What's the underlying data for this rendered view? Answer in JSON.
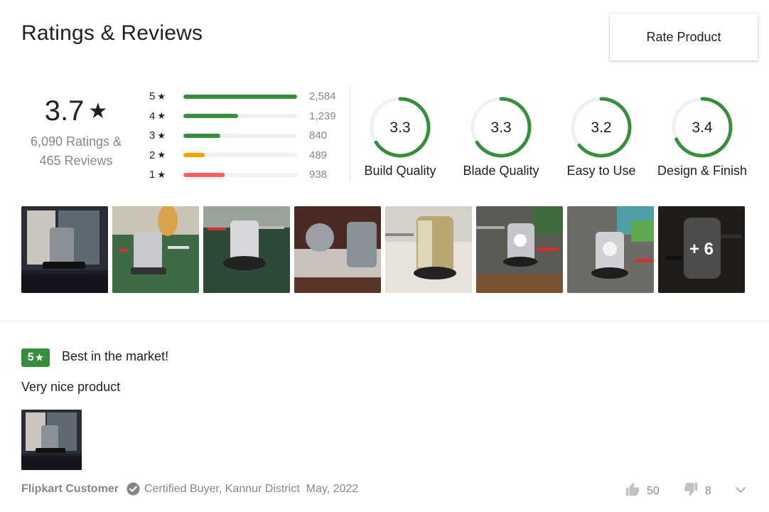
{
  "header": {
    "title": "Ratings & Reviews",
    "rate_button": "Rate Product"
  },
  "summary": {
    "average": "3.7",
    "star": "★",
    "ratings_line": "6,090 Ratings &",
    "reviews_line": "465 Reviews"
  },
  "distribution": [
    {
      "stars": "5",
      "count": "2,584",
      "fraction": 1.0,
      "color": "#388e3c"
    },
    {
      "stars": "4",
      "count": "1,239",
      "fraction": 0.48,
      "color": "#388e3c"
    },
    {
      "stars": "3",
      "count": "840",
      "fraction": 0.325,
      "color": "#388e3c"
    },
    {
      "stars": "2",
      "count": "489",
      "fraction": 0.19,
      "color": "#ff9f00"
    },
    {
      "stars": "1",
      "count": "938",
      "fraction": 0.363,
      "color": "#ff6161"
    }
  ],
  "aspects": [
    {
      "value": "3.3",
      "label": "Build Quality",
      "score": 3.3
    },
    {
      "value": "3.3",
      "label": "Blade Quality",
      "score": 3.3
    },
    {
      "value": "3.2",
      "label": "Easy to Use",
      "score": 3.2
    },
    {
      "value": "3.4",
      "label": "Design & Finish",
      "score": 3.4
    }
  ],
  "photos": {
    "count_visible": 8,
    "more_label": "+ 6"
  },
  "review": {
    "rating": "5",
    "star": "★",
    "title": "Best in the market!",
    "text": "Very nice product",
    "reviewer": "Flipkart Customer",
    "certified": "Certified Buyer, Kannur District",
    "date": "May, 2022",
    "likes": "50",
    "dislikes": "8"
  },
  "colors": {
    "accent_green": "#388e3c",
    "star_orange": "#ff9f00",
    "star_red": "#ff6161",
    "muted": "#878787"
  },
  "icons": [
    "star-icon",
    "thumbs-up-icon",
    "thumbs-down-icon",
    "check-circle-icon",
    "chevron-down-icon"
  ]
}
